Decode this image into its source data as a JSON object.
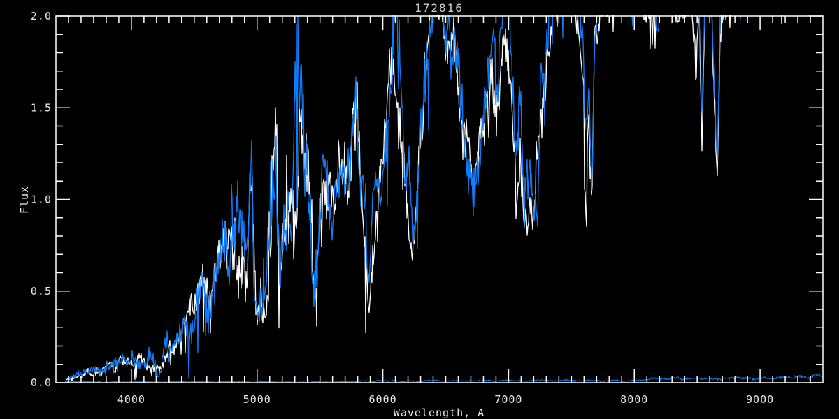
{
  "window": {
    "background": "#000000"
  },
  "chart_data": {
    "type": "line",
    "title": "172816",
    "xlabel": "Wavelength, A",
    "ylabel": "Flux",
    "xlim": [
      3400,
      9500
    ],
    "ylim": [
      0.0,
      2.0
    ],
    "x_tick_values": [
      4000,
      5000,
      6000,
      7000,
      8000,
      9000
    ],
    "x_tick_labels": [
      "4000",
      "5000",
      "6000",
      "7000",
      "8000",
      "9000"
    ],
    "x_minor_step": 100,
    "y_tick_values": [
      0.0,
      0.5,
      1.0,
      1.5,
      2.0
    ],
    "y_tick_labels": [
      "0.0",
      "0.5",
      "1.0",
      "1.5",
      "2.0"
    ],
    "y_minor_step": 0.1,
    "grid": false,
    "legend": null,
    "colors": {
      "background": "#000000",
      "axis": "#ffffff",
      "tick_text": "#e8e8e8",
      "title_text": "#cfcfcf",
      "observed": "#0f7dfb",
      "model": "#ffffff",
      "error": "#0f7dfb"
    },
    "series": [
      {
        "name": "observed-spectrum",
        "color": "#0f7dfb",
        "style": "noisy-line",
        "anchors": [
          [
            3480,
            0.02,
            0.02
          ],
          [
            3560,
            0.03,
            0.025
          ],
          [
            3650,
            0.05,
            0.03
          ],
          [
            3750,
            0.06,
            0.03
          ],
          [
            3850,
            0.08,
            0.04
          ],
          [
            3950,
            0.11,
            0.05
          ],
          [
            4050,
            0.12,
            0.05
          ],
          [
            4120,
            0.13,
            0.06
          ],
          [
            4180,
            0.12,
            0.07
          ],
          [
            4225,
            0.05,
            0.04
          ],
          [
            4265,
            0.17,
            0.08
          ],
          [
            4330,
            0.24,
            0.1
          ],
          [
            4420,
            0.3,
            0.13
          ],
          [
            4500,
            0.4,
            0.17
          ],
          [
            4580,
            0.47,
            0.2
          ],
          [
            4650,
            0.55,
            0.24
          ],
          [
            4710,
            0.62,
            0.27
          ],
          [
            4745,
            0.72,
            0.3
          ],
          [
            4770,
            0.55,
            0.27
          ],
          [
            4795,
            0.85,
            0.33
          ],
          [
            4820,
            0.6,
            0.28
          ],
          [
            4850,
            0.68,
            0.3
          ],
          [
            4880,
            0.75,
            0.32
          ],
          [
            4910,
            0.6,
            0.28
          ],
          [
            4935,
            0.8,
            0.38
          ],
          [
            4958,
            1.45,
            0.45
          ],
          [
            4975,
            0.6,
            0.33
          ],
          [
            4992,
            0.35,
            0.18
          ],
          [
            5012,
            0.5,
            0.22
          ],
          [
            5040,
            0.55,
            0.25
          ],
          [
            5070,
            0.5,
            0.22
          ],
          [
            5100,
            0.65,
            0.3
          ],
          [
            5128,
            1.0,
            0.4
          ],
          [
            5152,
            1.5,
            0.4
          ],
          [
            5170,
            0.75,
            0.3
          ],
          [
            5188,
            0.7,
            0.25
          ],
          [
            5215,
            0.8,
            0.28
          ],
          [
            5250,
            0.95,
            0.3
          ],
          [
            5282,
            1.0,
            0.32
          ],
          [
            5308,
            1.55,
            0.42
          ],
          [
            5332,
            1.35,
            0.4
          ],
          [
            5356,
            1.5,
            0.42
          ],
          [
            5382,
            1.1,
            0.35
          ],
          [
            5406,
            1.2,
            0.35
          ],
          [
            5430,
            1.0,
            0.34
          ],
          [
            5450,
            0.62,
            0.22
          ],
          [
            5472,
            0.75,
            0.25
          ],
          [
            5502,
            0.95,
            0.28
          ],
          [
            5540,
            1.15,
            0.25
          ],
          [
            5572,
            1.0,
            0.22
          ],
          [
            5602,
            0.93,
            0.2
          ],
          [
            5632,
            1.05,
            0.22
          ],
          [
            5665,
            1.15,
            0.25
          ],
          [
            5692,
            1.1,
            0.25
          ],
          [
            5722,
            1.25,
            0.28
          ],
          [
            5756,
            1.45,
            0.3
          ],
          [
            5790,
            1.6,
            0.3
          ],
          [
            5816,
            1.2,
            0.3
          ],
          [
            5842,
            1.0,
            0.25
          ],
          [
            5868,
            0.75,
            0.24
          ],
          [
            5888,
            0.55,
            0.16
          ],
          [
            5912,
            0.9,
            0.18
          ],
          [
            5946,
            1.0,
            0.18
          ],
          [
            5982,
            1.1,
            0.2
          ],
          [
            6022,
            1.35,
            0.25
          ],
          [
            6062,
            1.7,
            0.3
          ],
          [
            6092,
            1.95,
            0.3
          ],
          [
            6122,
            1.8,
            0.34
          ],
          [
            6152,
            1.45,
            0.34
          ],
          [
            6186,
            1.15,
            0.3
          ],
          [
            6220,
            0.95,
            0.25
          ],
          [
            6252,
            0.8,
            0.15
          ],
          [
            6276,
            0.95,
            0.2
          ],
          [
            6312,
            1.4,
            0.3
          ],
          [
            6346,
            1.8,
            0.3
          ],
          [
            6378,
            2.05,
            0.2
          ],
          [
            6420,
            2.1,
            0.14
          ],
          [
            6462,
            2.12,
            0.12
          ],
          [
            6496,
            1.85,
            0.24
          ],
          [
            6526,
            2.05,
            0.18
          ],
          [
            6562,
            1.95,
            0.25
          ],
          [
            6602,
            1.7,
            0.25
          ],
          [
            6662,
            1.3,
            0.22
          ],
          [
            6722,
            1.05,
            0.18
          ],
          [
            6782,
            1.35,
            0.22
          ],
          [
            6842,
            1.75,
            0.25
          ],
          [
            6882,
            2.0,
            0.22
          ],
          [
            6906,
            1.55,
            0.3
          ],
          [
            6928,
            1.9,
            0.25
          ],
          [
            6962,
            2.1,
            0.15
          ],
          [
            7002,
            2.05,
            0.2
          ],
          [
            7032,
            1.6,
            0.3
          ],
          [
            7062,
            1.1,
            0.25
          ],
          [
            7092,
            1.4,
            0.28
          ],
          [
            7126,
            0.98,
            0.22
          ],
          [
            7162,
            1.2,
            0.25
          ],
          [
            7202,
            0.92,
            0.2
          ],
          [
            7236,
            1.25,
            0.28
          ],
          [
            7266,
            1.7,
            0.3
          ],
          [
            7302,
            2.05,
            0.18
          ],
          [
            7362,
            2.12,
            0.12
          ],
          [
            7432,
            2.12,
            0.13
          ],
          [
            7502,
            2.12,
            0.12
          ],
          [
            7562,
            2.1,
            0.14
          ],
          [
            7592,
            1.9,
            0.2
          ],
          [
            7614,
            1.35,
            0.25
          ],
          [
            7636,
            1.7,
            0.22
          ],
          [
            7662,
            1.2,
            0.25
          ],
          [
            7686,
            1.9,
            0.18
          ],
          [
            7722,
            2.1,
            0.12
          ],
          [
            7802,
            2.13,
            0.1
          ],
          [
            7902,
            2.13,
            0.1
          ],
          [
            8002,
            2.13,
            0.1
          ],
          [
            8102,
            2.12,
            0.11
          ],
          [
            8162,
            2.05,
            0.15
          ],
          [
            8212,
            2.02,
            0.16
          ],
          [
            8262,
            2.12,
            0.1
          ],
          [
            8342,
            2.13,
            0.1
          ],
          [
            8422,
            2.05,
            0.12
          ],
          [
            8452,
            2.13,
            0.09
          ],
          [
            8494,
            1.98,
            0.15
          ],
          [
            8514,
            2.1,
            0.1
          ],
          [
            8538,
            1.45,
            0.12
          ],
          [
            8562,
            2.08,
            0.1
          ],
          [
            8612,
            2.13,
            0.09
          ],
          [
            8660,
            1.22,
            0.1
          ],
          [
            8686,
            2.08,
            0.1
          ],
          [
            8752,
            2.13,
            0.09
          ],
          [
            8902,
            2.14,
            0.09
          ],
          [
            9102,
            2.14,
            0.09
          ],
          [
            9302,
            2.14,
            0.09
          ],
          [
            9500,
            2.14,
            0.09
          ]
        ]
      },
      {
        "name": "model-spectrum",
        "color": "#ffffff",
        "style": "noisy-line",
        "anchors": [
          [
            3480,
            0.02,
            0.015
          ],
          [
            3700,
            0.05,
            0.025
          ],
          [
            3900,
            0.1,
            0.04
          ],
          [
            4100,
            0.13,
            0.05
          ],
          [
            4225,
            0.06,
            0.04
          ],
          [
            4350,
            0.25,
            0.09
          ],
          [
            4500,
            0.4,
            0.15
          ],
          [
            4650,
            0.55,
            0.2
          ],
          [
            4745,
            0.7,
            0.26
          ],
          [
            4795,
            0.82,
            0.3
          ],
          [
            4850,
            0.66,
            0.26
          ],
          [
            4910,
            0.62,
            0.26
          ],
          [
            4958,
            1.3,
            0.4
          ],
          [
            4992,
            0.38,
            0.18
          ],
          [
            5040,
            0.54,
            0.22
          ],
          [
            5100,
            0.63,
            0.26
          ],
          [
            5152,
            1.4,
            0.38
          ],
          [
            5170,
            0.72,
            0.26
          ],
          [
            5215,
            0.78,
            0.26
          ],
          [
            5282,
            0.98,
            0.3
          ],
          [
            5332,
            1.4,
            0.4
          ],
          [
            5382,
            1.1,
            0.32
          ],
          [
            5430,
            0.95,
            0.3
          ],
          [
            5450,
            0.6,
            0.2
          ],
          [
            5502,
            0.92,
            0.25
          ],
          [
            5540,
            1.12,
            0.22
          ],
          [
            5602,
            0.9,
            0.18
          ],
          [
            5665,
            1.12,
            0.22
          ],
          [
            5722,
            1.22,
            0.25
          ],
          [
            5790,
            1.55,
            0.28
          ],
          [
            5842,
            0.98,
            0.22
          ],
          [
            5888,
            0.52,
            0.16
          ],
          [
            5946,
            0.98,
            0.16
          ],
          [
            6022,
            1.32,
            0.22
          ],
          [
            6092,
            1.9,
            0.28
          ],
          [
            6152,
            1.4,
            0.32
          ],
          [
            6220,
            0.9,
            0.22
          ],
          [
            6252,
            0.76,
            0.14
          ],
          [
            6312,
            1.35,
            0.28
          ],
          [
            6378,
            2.02,
            0.18
          ],
          [
            6462,
            2.1,
            0.11
          ],
          [
            6496,
            1.8,
            0.22
          ],
          [
            6562,
            1.92,
            0.22
          ],
          [
            6662,
            1.28,
            0.2
          ],
          [
            6722,
            1.02,
            0.16
          ],
          [
            6782,
            1.32,
            0.2
          ],
          [
            6842,
            1.72,
            0.22
          ],
          [
            6906,
            1.5,
            0.28
          ],
          [
            6962,
            2.08,
            0.13
          ],
          [
            7032,
            1.55,
            0.28
          ],
          [
            7062,
            1.05,
            0.22
          ],
          [
            7126,
            0.94,
            0.2
          ],
          [
            7202,
            0.88,
            0.18
          ],
          [
            7266,
            1.65,
            0.28
          ],
          [
            7362,
            2.1,
            0.11
          ],
          [
            7502,
            2.1,
            0.11
          ],
          [
            7592,
            1.8,
            0.18
          ],
          [
            7614,
            1.05,
            0.2
          ],
          [
            7636,
            1.6,
            0.2
          ],
          [
            7662,
            0.98,
            0.2
          ],
          [
            7686,
            1.85,
            0.16
          ],
          [
            7802,
            2.11,
            0.09
          ],
          [
            8002,
            2.11,
            0.09
          ],
          [
            8162,
            2.02,
            0.13
          ],
          [
            8262,
            2.11,
            0.09
          ],
          [
            8422,
            1.95,
            0.1
          ],
          [
            8452,
            2.11,
            0.08
          ],
          [
            8494,
            1.78,
            0.12
          ],
          [
            8514,
            2.08,
            0.09
          ],
          [
            8538,
            1.25,
            0.1
          ],
          [
            8562,
            2.06,
            0.09
          ],
          [
            8612,
            2.11,
            0.08
          ],
          [
            8660,
            1.05,
            0.09
          ],
          [
            8686,
            2.06,
            0.09
          ],
          [
            8802,
            2.12,
            0.08
          ],
          [
            9102,
            2.12,
            0.08
          ],
          [
            9500,
            2.12,
            0.08
          ]
        ]
      },
      {
        "name": "error-spectrum",
        "color": "#0f7dfb",
        "style": "noisy-line",
        "anchors": [
          [
            3470,
            0.006,
            0.004
          ],
          [
            4500,
            0.007,
            0.004
          ],
          [
            5500,
            0.008,
            0.005
          ],
          [
            6500,
            0.01,
            0.005
          ],
          [
            7000,
            0.011,
            0.005
          ],
          [
            7600,
            0.012,
            0.006
          ],
          [
            8100,
            0.012,
            0.006
          ],
          [
            8135,
            0.022,
            0.008
          ],
          [
            8700,
            0.022,
            0.008
          ],
          [
            9100,
            0.026,
            0.01
          ],
          [
            9350,
            0.032,
            0.013
          ],
          [
            9500,
            0.034,
            0.014
          ]
        ]
      }
    ]
  }
}
